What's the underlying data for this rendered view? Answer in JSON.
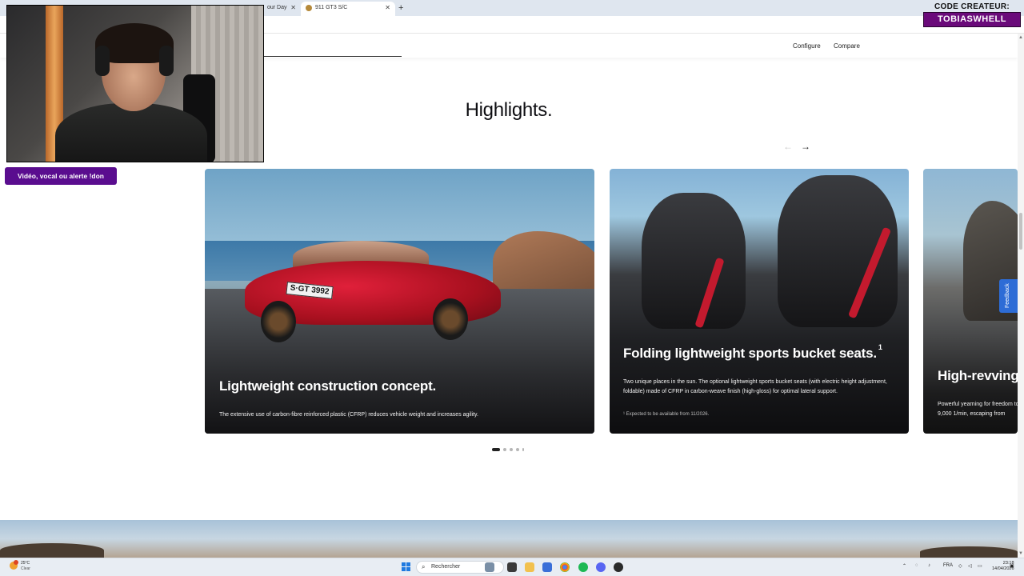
{
  "browser": {
    "tabs": [
      {
        "label": "our Day",
        "active": false
      },
      {
        "label": "911 GT3 S/C",
        "active": true
      }
    ],
    "close_glyph": "✕",
    "newtab_glyph": "+"
  },
  "nav": {
    "configure": "Configure",
    "compare": "Compare"
  },
  "section": {
    "title": "Highlights.",
    "prev_arrow": "←",
    "next_arrow": "→"
  },
  "cards": [
    {
      "title": "Lightweight construction concept.",
      "text": "The extensive use of carbon-fibre reinforced plastic (CFRP) reduces vehicle weight and increases agility.",
      "plate": "S·GT 3992"
    },
    {
      "title": "Folding lightweight sports bucket seats.",
      "sup": "1",
      "text": "Two unique places in the sun. The optional lightweight sports bucket seats (with electric height adjustment, foldable) made of CFRP in carbon-weave finish (high-gloss) for optimal lateral support.",
      "footnote": "¹ Expected to be available from 11/2026."
    },
    {
      "title": "High-revving",
      "text": "Powerful yearning for freedom to 9,000 1/min, escaping from"
    }
  ],
  "carousel": {
    "total_dots": 5,
    "active_dot": 1
  },
  "feedback": "Feedback",
  "stream": {
    "alert_button": "Vidéo, vocal ou alerte !don",
    "creator_label": "CODE CREATEUR:",
    "creator_name": "TOBIASWHELL"
  },
  "taskbar": {
    "temp": "25°C",
    "condition": "Clear",
    "search_placeholder": "Rechercher",
    "lang": "FRA",
    "time": "23:18",
    "date": "14/04/2026"
  },
  "colors": {
    "accent_purple": "#5a0d8f",
    "feedback_blue": "#2d6cd6",
    "car_red": "#c8102e"
  },
  "icons": [
    "search-icon",
    "windows-start-icon",
    "chrome-icon",
    "spotify-icon",
    "folder-icon",
    "wifi-icon",
    "volume-icon",
    "battery-icon"
  ]
}
